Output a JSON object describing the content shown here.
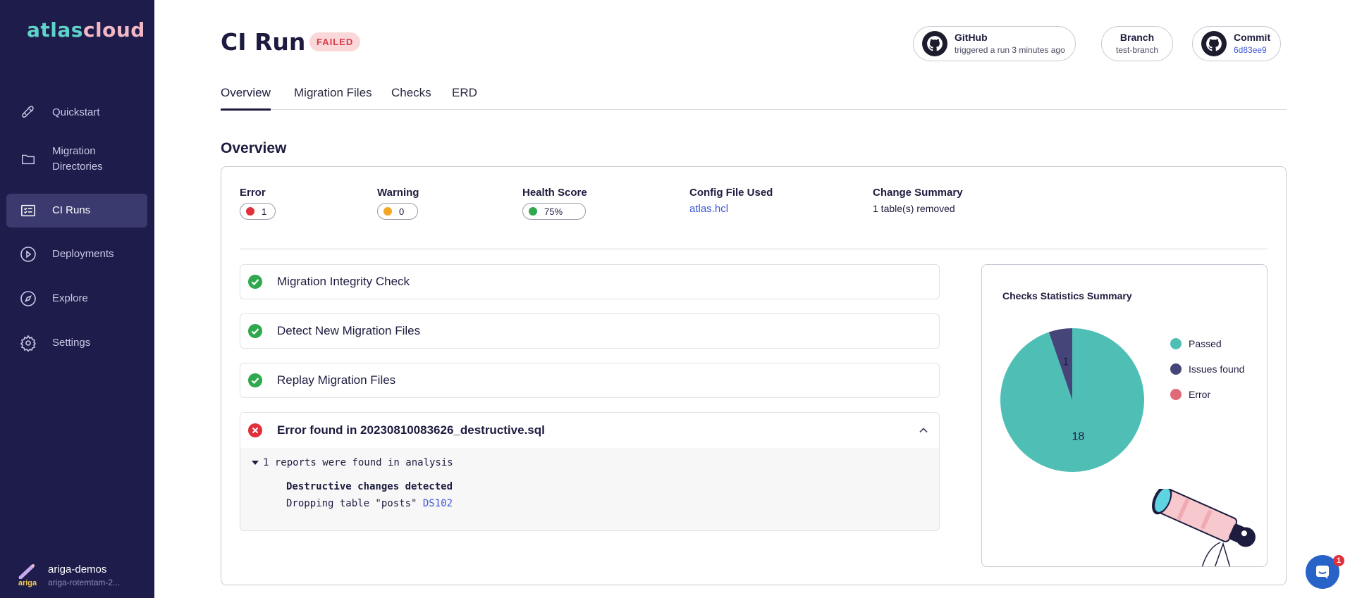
{
  "app": {
    "logo_part1": "atlas",
    "logo_part2": "cloud"
  },
  "sidebar": {
    "items": [
      {
        "label": "Quickstart",
        "icon": "rocket-icon"
      },
      {
        "label": "Migration Directories",
        "icon": "folder-icon"
      },
      {
        "label": "CI Runs",
        "icon": "list-icon",
        "active": true
      },
      {
        "label": "Deployments",
        "icon": "play-circle-icon"
      },
      {
        "label": "Explore",
        "icon": "compass-icon"
      },
      {
        "label": "Settings",
        "icon": "gear-icon"
      }
    ],
    "org": {
      "name": "ariga-demos",
      "sub": "ariga-rotemtam-2...",
      "logo_text": "ariga"
    }
  },
  "header": {
    "title": "CI Run",
    "status": "FAILED",
    "pills": {
      "github": {
        "title": "GitHub",
        "sub": "triggered a run 3 minutes ago"
      },
      "branch": {
        "title": "Branch",
        "sub": "test-branch"
      },
      "commit": {
        "title": "Commit",
        "sub": "6d83ee9"
      }
    }
  },
  "tabs": [
    "Overview",
    "Migration Files",
    "Checks",
    "ERD"
  ],
  "overview": {
    "section_title": "Overview",
    "stats": {
      "error": {
        "label": "Error",
        "value": "1",
        "color": "#e0303c"
      },
      "warning": {
        "label": "Warning",
        "value": "0",
        "color": "#f5a623"
      },
      "health": {
        "label": "Health Score",
        "value": "75%",
        "color": "#2fa84f"
      },
      "config": {
        "label": "Config File Used",
        "value": "atlas.hcl"
      },
      "change": {
        "label": "Change Summary",
        "value": "1 table(s) removed"
      }
    },
    "checks": [
      {
        "label": "Migration Integrity Check",
        "status": "passed"
      },
      {
        "label": "Detect New Migration Files",
        "status": "passed"
      },
      {
        "label": "Replay Migration Files",
        "status": "passed"
      }
    ],
    "error_check": {
      "label": "Error found in 20230810083626_destructive.sql",
      "reports_summary": "1 reports were found in analysis",
      "report_title": "Destructive changes detected",
      "report_message": "Dropping table \"posts\"",
      "report_code": "DS102"
    }
  },
  "chart_data": {
    "type": "pie",
    "title": "Checks Statistics Summary",
    "categories": [
      "Passed",
      "Issues found",
      "Error"
    ],
    "values": [
      18,
      1,
      0
    ],
    "colors": [
      "#4fbfb5",
      "#46457a",
      "#e06b78"
    ],
    "legend": "right"
  },
  "chat": {
    "badge": "1"
  }
}
